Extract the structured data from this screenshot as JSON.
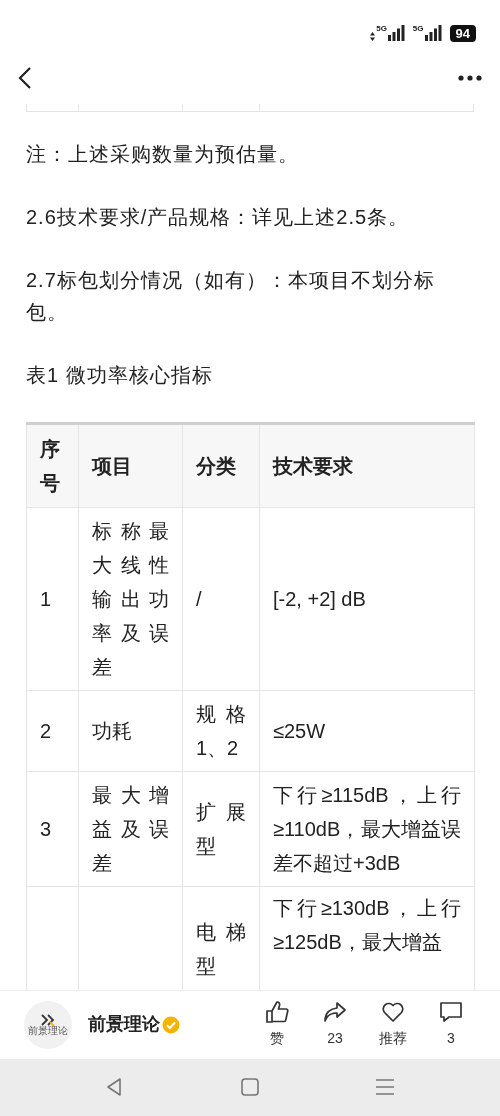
{
  "status_bar": {
    "signals": [
      {
        "network": "5G"
      },
      {
        "network": "5G"
      }
    ],
    "battery": "94"
  },
  "paragraphs": [
    "注：上述采购数量为预估量。",
    "2.6技术要求/产品规格：详见上述2.5条。",
    "2.7标包划分情况（如有）：本项目不划分标包。",
    "表1 微功率核心指标"
  ],
  "table": {
    "columns": [
      "序号",
      "项目",
      "分类",
      "技术要求"
    ],
    "rows": [
      {
        "no": "1",
        "item": "标称最大线性输出功率及误差",
        "category": "/",
        "requirement": "[-2, +2] dB"
      },
      {
        "no": "2",
        "item": "功耗",
        "category": "规格1、2",
        "requirement": "≤25W"
      },
      {
        "no": "3",
        "item": "最大增益及误差",
        "category": "扩展型",
        "requirement": "下行≥115dB，上行≥110dB，最大增益误差不超过+3dB"
      },
      {
        "category": "电梯型",
        "requirement": "下行≥130dB，上行≥125dB，最大增益"
      }
    ]
  },
  "author": {
    "avatar_caption": "前景理论",
    "name": "前景理论",
    "verified": true
  },
  "actions": [
    {
      "kind": "like",
      "label": "赞"
    },
    {
      "kind": "share",
      "label": "23"
    },
    {
      "kind": "recommend",
      "label": "推荐"
    },
    {
      "kind": "comment",
      "label": "3"
    }
  ]
}
